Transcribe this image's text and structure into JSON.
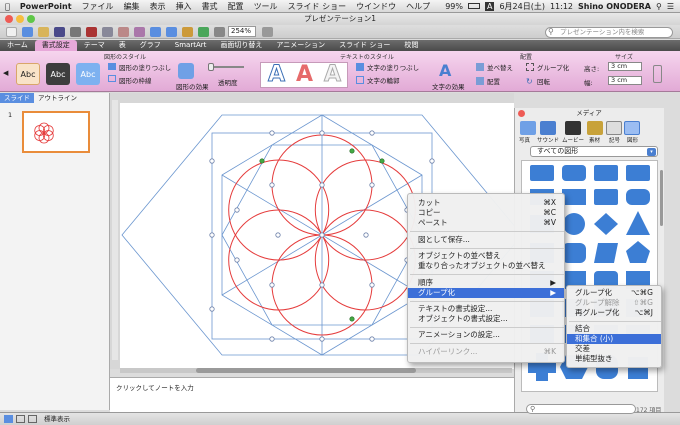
{
  "menubar": {
    "apple": "",
    "app": "PowerPoint",
    "items": [
      "ファイル",
      "編集",
      "表示",
      "挿入",
      "書式",
      "配置",
      "ツール",
      "スライド ショー",
      "ウインドウ",
      "ヘルプ"
    ],
    "battery": "99%",
    "date": "6月24日(土)",
    "time": "11:12",
    "user": "Shino ONODERA"
  },
  "window": {
    "title": "プレゼンテーション1"
  },
  "toolbar": {
    "zoom": "254%",
    "search_placeholder": "プレゼンテーション内を検索"
  },
  "tabs": [
    "ホーム",
    "書式設定",
    "テーマ",
    "表",
    "グラフ",
    "SmartArt",
    "画面切り替え",
    "アニメーション",
    "スライド ショー",
    "校閲"
  ],
  "ribbon": {
    "group_shape_styles": "図形のスタイル",
    "group_text_styles": "テキストのスタイル",
    "group_arrange": "配置",
    "group_size": "サイズ",
    "style_abc": "Abc",
    "shape_fill": "図形の塗りつぶし",
    "shape_outline": "図形の枠線",
    "shape_effects": "図形の効果",
    "transparency": "透明度",
    "text_fill": "文字の塗りつぶし",
    "text_outline": "文字の輪郭",
    "text_effects": "文字の効果",
    "reorder": "並べ替え",
    "group": "グループ化",
    "align": "配置",
    "rotate": "回転",
    "height_label": "高さ:",
    "height_value": "3 cm",
    "width_label": "幅:",
    "width_value": "3 cm"
  },
  "left_panel": {
    "tab_slides": "スライド",
    "tab_outline": "アウトライン",
    "slide_number": "1"
  },
  "notes": {
    "placeholder": "クリックしてノートを入力"
  },
  "status": {
    "view": "標準表示"
  },
  "context_menu": {
    "items": [
      {
        "label": "カット",
        "shortcut": "⌘X"
      },
      {
        "label": "コピー",
        "shortcut": "⌘C"
      },
      {
        "label": "ペースト",
        "shortcut": "⌘V"
      },
      {
        "label": "図として保存...",
        "shortcut": ""
      },
      {
        "label": "オブジェクトの並べ替え",
        "shortcut": ""
      },
      {
        "label": "重なり合ったオブジェクトの並べ替え",
        "shortcut": ""
      },
      {
        "label": "順序",
        "shortcut": "▶"
      },
      {
        "label": "グループ化",
        "shortcut": "▶"
      },
      {
        "label": "テキストの書式設定...",
        "shortcut": ""
      },
      {
        "label": "オブジェクトの書式設定...",
        "shortcut": ""
      },
      {
        "label": "アニメーションの設定...",
        "shortcut": ""
      },
      {
        "label": "ハイパーリンク...",
        "shortcut": "⌘K"
      }
    ]
  },
  "submenu": {
    "items": [
      {
        "label": "グループ化",
        "shortcut": "⌥⌘G"
      },
      {
        "label": "グループ解除",
        "shortcut": "⇧⌘G"
      },
      {
        "label": "再グループ化",
        "shortcut": "⌥⌘J"
      },
      {
        "label": "結合",
        "shortcut": ""
      },
      {
        "label": "和集合 (小)",
        "shortcut": ""
      },
      {
        "label": "交差",
        "shortcut": ""
      },
      {
        "label": "単純型抜き",
        "shortcut": ""
      }
    ]
  },
  "media": {
    "title": "メディア",
    "buttons": [
      "写真",
      "サウンド",
      "ムービー",
      "素材",
      "記号",
      "図形"
    ],
    "filter": "すべての図形",
    "count": "172 項目"
  },
  "colors": {
    "accent": "#3c6fd8",
    "ribbon": "#e2aad6",
    "circle": "#e53c3c",
    "guide": "#6b96cf"
  }
}
